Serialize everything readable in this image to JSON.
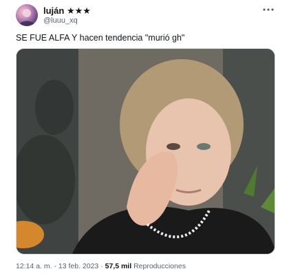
{
  "author": {
    "display_name": "luján ★★★",
    "handle": "@luuu_xq",
    "avatar_icon": "profile-avatar"
  },
  "tweet": {
    "text": "SE FUE ALFA Y hacen tendencia \"murió gh\"",
    "more_icon": "more-options-icon"
  },
  "media": {
    "type": "photo"
  },
  "meta": {
    "time": "12:14 a. m.",
    "separator": "·",
    "date": "13 feb. 2023",
    "views_count": "57,5 mil",
    "views_label": "Reproducciones"
  }
}
